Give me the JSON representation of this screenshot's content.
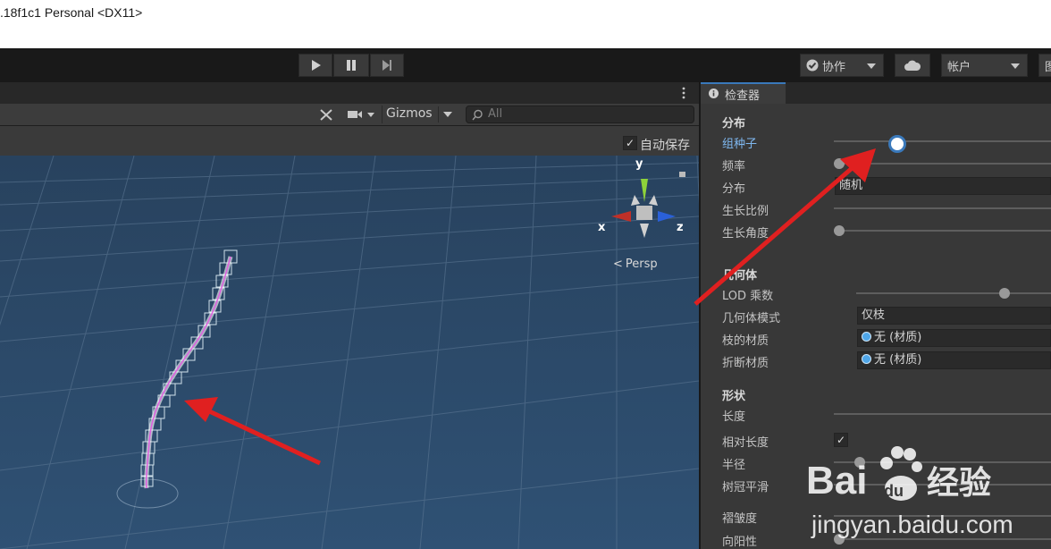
{
  "window": {
    "title": ".18f1c1 Personal <DX11>"
  },
  "toolbar": {
    "play_icon": "play-icon",
    "pause_icon": "pause-icon",
    "step_icon": "step-icon",
    "collab_label": "协作",
    "account_label": "帐户",
    "layers_label": "图"
  },
  "scene": {
    "gizmos_label": "Gizmos",
    "search_placeholder": "All",
    "autosave_label": "自动保存",
    "autosave_checked": true,
    "persp_label": "Persp",
    "axis_y": "y",
    "axis_x": "x",
    "axis_z": "z"
  },
  "inspector": {
    "tab_label": "检查器",
    "sections": {
      "distribution": {
        "header": "分布",
        "group_seed": "组种子",
        "frequency": "频率",
        "distribution": "分布",
        "distribution_value": "随机",
        "growth_scale": "生长比例",
        "growth_angle": "生长角度"
      },
      "geometry": {
        "header": "几何体",
        "lod_multiplier": "LOD 乘数",
        "geometry_mode": "几何体模式",
        "geometry_mode_value": "仅枝",
        "branch_material": "枝的材质",
        "branch_material_value": "无 (材质)",
        "break_material": "折断材质",
        "break_material_value": "无 (材质)"
      },
      "shape": {
        "header": "形状",
        "length": "长度",
        "relative_length": "相对长度",
        "relative_length_checked": true,
        "radius": "半径",
        "crown_smooth": "树冠平滑",
        "crinkliness": "褶皱度",
        "seek_sun": "向阳性"
      }
    }
  },
  "watermark": {
    "brand": "Baidu",
    "brand_cn": "经验",
    "url": "jingyan.baidu.com"
  },
  "colors": {
    "accent": "#3a79bb",
    "arrow": "#e02020",
    "sky": "#2b4a6a"
  }
}
